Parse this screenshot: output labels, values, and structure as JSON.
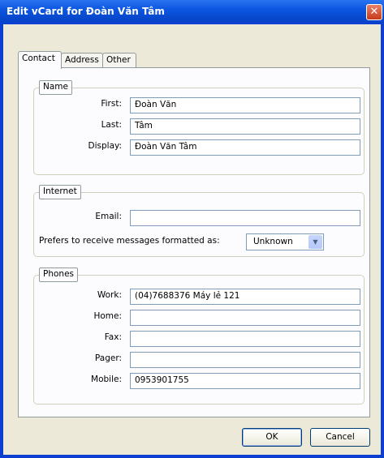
{
  "window": {
    "title": "Edit vCard for Đoàn Văn Tâm",
    "close_glyph": "✕"
  },
  "tabs": [
    {
      "label": "Contact",
      "active": true
    },
    {
      "label": "Address",
      "active": false
    },
    {
      "label": "Other",
      "active": false
    }
  ],
  "name_group": {
    "title": "Name",
    "first": {
      "label": "First:",
      "value": "Đoàn Văn"
    },
    "last": {
      "label": "Last:",
      "value": "Tâm"
    },
    "display": {
      "label": "Display:",
      "value": "Đoàn Văn Tâm"
    }
  },
  "internet_group": {
    "title": "Internet",
    "email": {
      "label": "Email:",
      "value": ""
    },
    "format": {
      "label": "Prefers to receive messages formatted as:",
      "selected": "Unknown"
    }
  },
  "phones_group": {
    "title": "Phones",
    "work": {
      "label": "Work:",
      "value": "(04)7688376 Máy lẻ 121"
    },
    "home": {
      "label": "Home:",
      "value": ""
    },
    "fax": {
      "label": "Fax:",
      "value": ""
    },
    "pager": {
      "label": "Pager:",
      "value": ""
    },
    "mobile": {
      "label": "Mobile:",
      "value": "0953901755"
    }
  },
  "buttons": {
    "ok": "OK",
    "cancel": "Cancel"
  },
  "icons": {
    "close": "close-icon",
    "dropdown": "chevron-down-icon"
  },
  "colors": {
    "titlebar": "#0a55e0",
    "dialog_bg": "#ece9d8",
    "panel_bg": "#fcfcfe",
    "field_border": "#7f9db9"
  }
}
